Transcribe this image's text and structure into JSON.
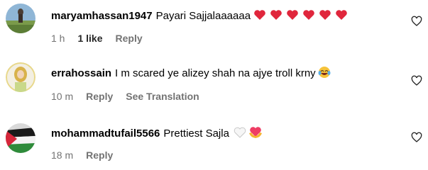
{
  "comments": [
    {
      "username": "maryamhassan1947",
      "text": "Payari Sajjalaaaaaa",
      "time": "1 h",
      "likes": "1 like",
      "reply": "Reply",
      "emoji": "six-red-hearts",
      "avatar": "landscape-photo"
    },
    {
      "username": "errahossain",
      "text": "I m scared ye alizey shah na ajye troll krny",
      "time": "10 m",
      "reply": "Reply",
      "translation": "See Translation",
      "emoji": "laughing-crying-face",
      "avatar": "woman-photo"
    },
    {
      "username": "mohammadtufail5566",
      "text": "Prettiest Sajla",
      "time": "18 m",
      "reply": "Reply",
      "emoji": "white-heart-and-heart-hands",
      "avatar": "flag-photo"
    }
  ],
  "colors": {
    "meta": "#737373",
    "heart_red": "#e0263c"
  }
}
